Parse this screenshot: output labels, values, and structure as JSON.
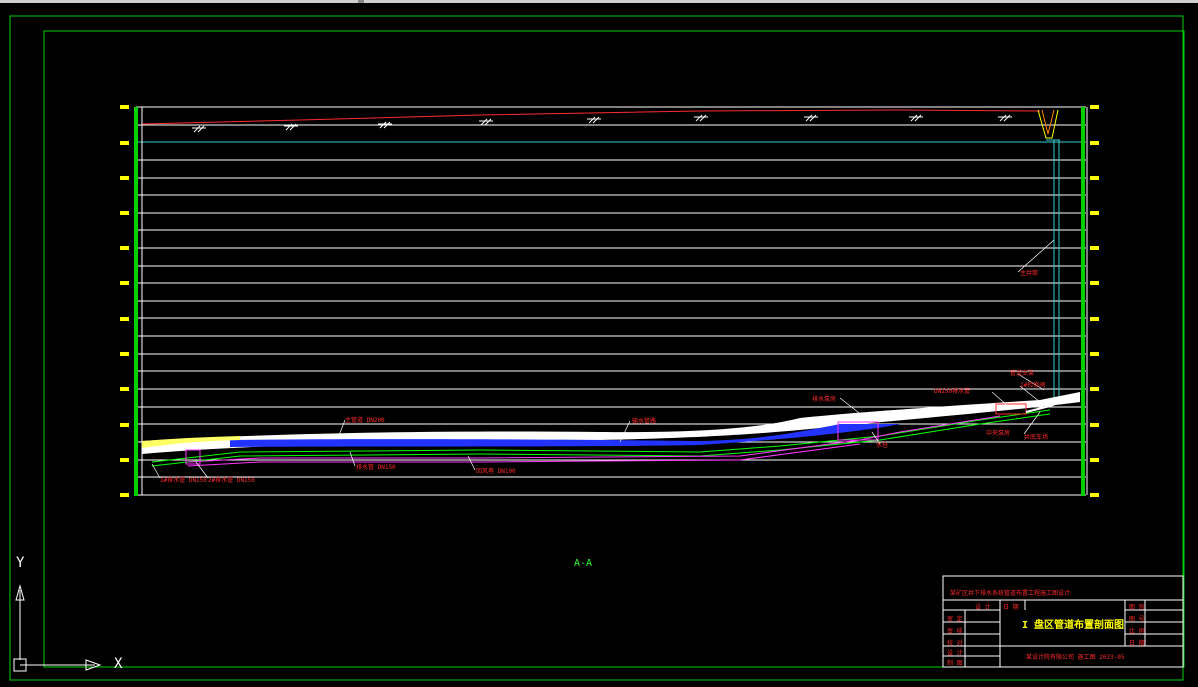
{
  "drawing": {
    "section_label": "A-A",
    "title": "I 盘区管道布置剖面图",
    "project_line": "某矿区井下排水系统管道布置工程施工图设计",
    "bottom_line": "某设计院有限公司 施工图 2023-05"
  },
  "title_block": {
    "header": [
      "设 计",
      "日 期"
    ],
    "rows_left": [
      "审 定",
      "审 核",
      "校 对",
      "设 计",
      "制 图"
    ],
    "rows_right": [
      "图 别",
      "图 号",
      "比 例",
      "日 期"
    ]
  },
  "annotations": [
    "主管道 DN200",
    "排水管 DN150",
    "回风巷 DN100",
    "1#排水管 DN150",
    "2#排水管 DN150",
    "输水管路",
    "排水泵房",
    "水仓",
    "主井筒",
    "DN150排水管",
    "管道支架",
    "1#检修阀",
    "中央泵房",
    "井底车场"
  ],
  "ucs": {
    "x_label": "X",
    "y_label": "Y"
  },
  "colors": {
    "border": "#00d000",
    "grid": "#ffffff",
    "accent_yellow": "#ffff00",
    "pipe_red": "#ff2a2a",
    "pipe_magenta": "#ff33ff",
    "pipe_green": "#00ff00",
    "pipe_cyan": "#33cccc",
    "pipe_blue": "#2233ff"
  }
}
